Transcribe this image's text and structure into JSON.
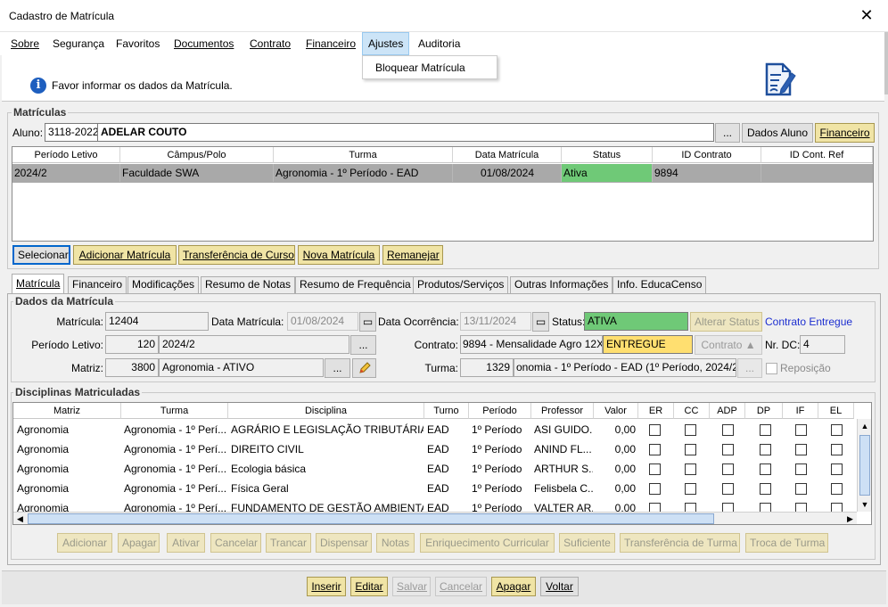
{
  "window": {
    "title": "Cadastro de Matrícula",
    "close_glyph": "✕"
  },
  "menu": [
    {
      "label": "Sobre"
    },
    {
      "label": "Segurança"
    },
    {
      "label": "Favoritos"
    },
    {
      "label": "Documentos"
    },
    {
      "label": "Contrato"
    },
    {
      "label": "Financeiro"
    },
    {
      "label": "Ajustes"
    },
    {
      "label": "Auditoria"
    }
  ],
  "ajustes_menu": {
    "item": "Bloquear Matrícula"
  },
  "info": {
    "message": "Favor informar os dados da Matrícula.",
    "icon": "info-icon",
    "doc_icon": "document-edit-icon"
  },
  "matriculas": {
    "group_title": "Matrículas",
    "aluno_label": "Aluno:",
    "aluno_code": "3118-2022",
    "aluno_name": "ADELAR COUTO",
    "ellipsis": "...",
    "dados_aluno": "Dados Aluno",
    "financeiro": "Financeiro",
    "columns": [
      "Período Letivo",
      "Câmpus/Polo",
      "Turma",
      "Data Matrícula",
      "Status",
      "ID Contrato",
      "ID Cont. Ref"
    ],
    "rows": [
      {
        "periodo": "2024/2",
        "campus": "Faculdade SWA",
        "turma": "Agronomia - 1º Período - EAD",
        "data": "01/08/2024",
        "status": "Ativa",
        "id_contrato": "9894",
        "id_ref": ""
      }
    ],
    "buttons": {
      "selecionar": "Selecionar",
      "adicionar": "Adicionar Matrícula",
      "transferencia": "Transferência de Curso",
      "nova": "Nova Matrícula",
      "remanejar": "Remanejar"
    }
  },
  "tabs": [
    "Matrícula",
    "Financeiro",
    "Modificações",
    "Resumo de Notas",
    "Resumo de Frequência",
    "Produtos/Serviços",
    "Outras Informações",
    "Info. EducaCenso"
  ],
  "dados": {
    "group_title": "Dados da Matrícula",
    "matricula_label": "Matrícula:",
    "matricula": "12404",
    "data_matricula_label": "Data Matrícula:",
    "data_matricula": "01/08/2024",
    "data_ocorrencia_label": "Data Ocorrência:",
    "data_ocorrencia": "13/11/2024",
    "status_label": "Status:",
    "status": "ATIVA",
    "alterar_status": "Alterar Status",
    "contrato_entregue": "Contrato Entregue",
    "periodo_label": "Período Letivo:",
    "periodo_code": "120",
    "periodo": "2024/2",
    "contrato_label": "Contrato:",
    "contrato": "9894 - Mensalidade Agro 12X",
    "contrato_status": "ENTREGUE",
    "contrato_btn": "Contrato",
    "nr_dc_label": "Nr. DC:",
    "nr_dc": "4",
    "matriz_label": "Matriz:",
    "matriz_code": "3800",
    "matriz": "Agronomia - ATIVO",
    "turma_label": "Turma:",
    "turma_code": "1329",
    "turma": "onomia - 1º Período - EAD (1º Período, 2024/2)",
    "reposicao": "Reposição",
    "ellipsis": "..."
  },
  "disciplinas": {
    "group_title": "Disciplinas Matriculadas",
    "columns": [
      "Matriz",
      "Turma",
      "Disciplina",
      "Turno",
      "Período",
      "Professor",
      "Valor",
      "ER",
      "CC",
      "ADP",
      "DP",
      "IF",
      "EL"
    ],
    "rows": [
      {
        "matriz": "Agronomia",
        "turma": "Agronomia - 1º Perí...",
        "disciplina": "AGRÁRIO E LEGISLAÇÃO TRIBUTÁRIA",
        "turno": "EAD",
        "periodo": "1º Período",
        "professor": "ASI GUIDO...",
        "valor": "0,00"
      },
      {
        "matriz": "Agronomia",
        "turma": "Agronomia - 1º Perí...",
        "disciplina": "DIREITO CIVIL",
        "turno": "EAD",
        "periodo": "1º Período",
        "professor": "ANIND FL...",
        "valor": "0,00"
      },
      {
        "matriz": "Agronomia",
        "turma": "Agronomia - 1º Perí...",
        "disciplina": "Ecologia básica",
        "turno": "EAD",
        "periodo": "1º Período",
        "professor": "ARTHUR S...",
        "valor": "0,00"
      },
      {
        "matriz": "Agronomia",
        "turma": "Agronomia - 1º Perí...",
        "disciplina": "Física Geral",
        "turno": "EAD",
        "periodo": "1º Período",
        "professor": "Felisbela C...",
        "valor": "0,00"
      },
      {
        "matriz": "Agronomia",
        "turma": "Agronomia - 1º Perí...",
        "disciplina": "FUNDAMENTO DE GESTÃO AMBIENTAL",
        "turno": "EAD",
        "periodo": "1º Período",
        "professor": "VALTER AR...",
        "valor": "0,00"
      }
    ],
    "actions": [
      "Adicionar",
      "Apagar",
      "Ativar",
      "Cancelar",
      "Trancar",
      "Dispensar",
      "Notas",
      "Enriquecimento Curricular",
      "Suficiente",
      "Transferência de Turma",
      "Troca de Turma"
    ]
  },
  "footer": [
    "Inserir",
    "Editar",
    "Salvar",
    "Cancelar",
    "Apagar",
    "Voltar"
  ],
  "colors": {
    "status_green": "#6fc977",
    "selected_row": "#a9a9a9",
    "status_yellow": "#ffdf70",
    "info_blue": "#1e5fbf"
  }
}
